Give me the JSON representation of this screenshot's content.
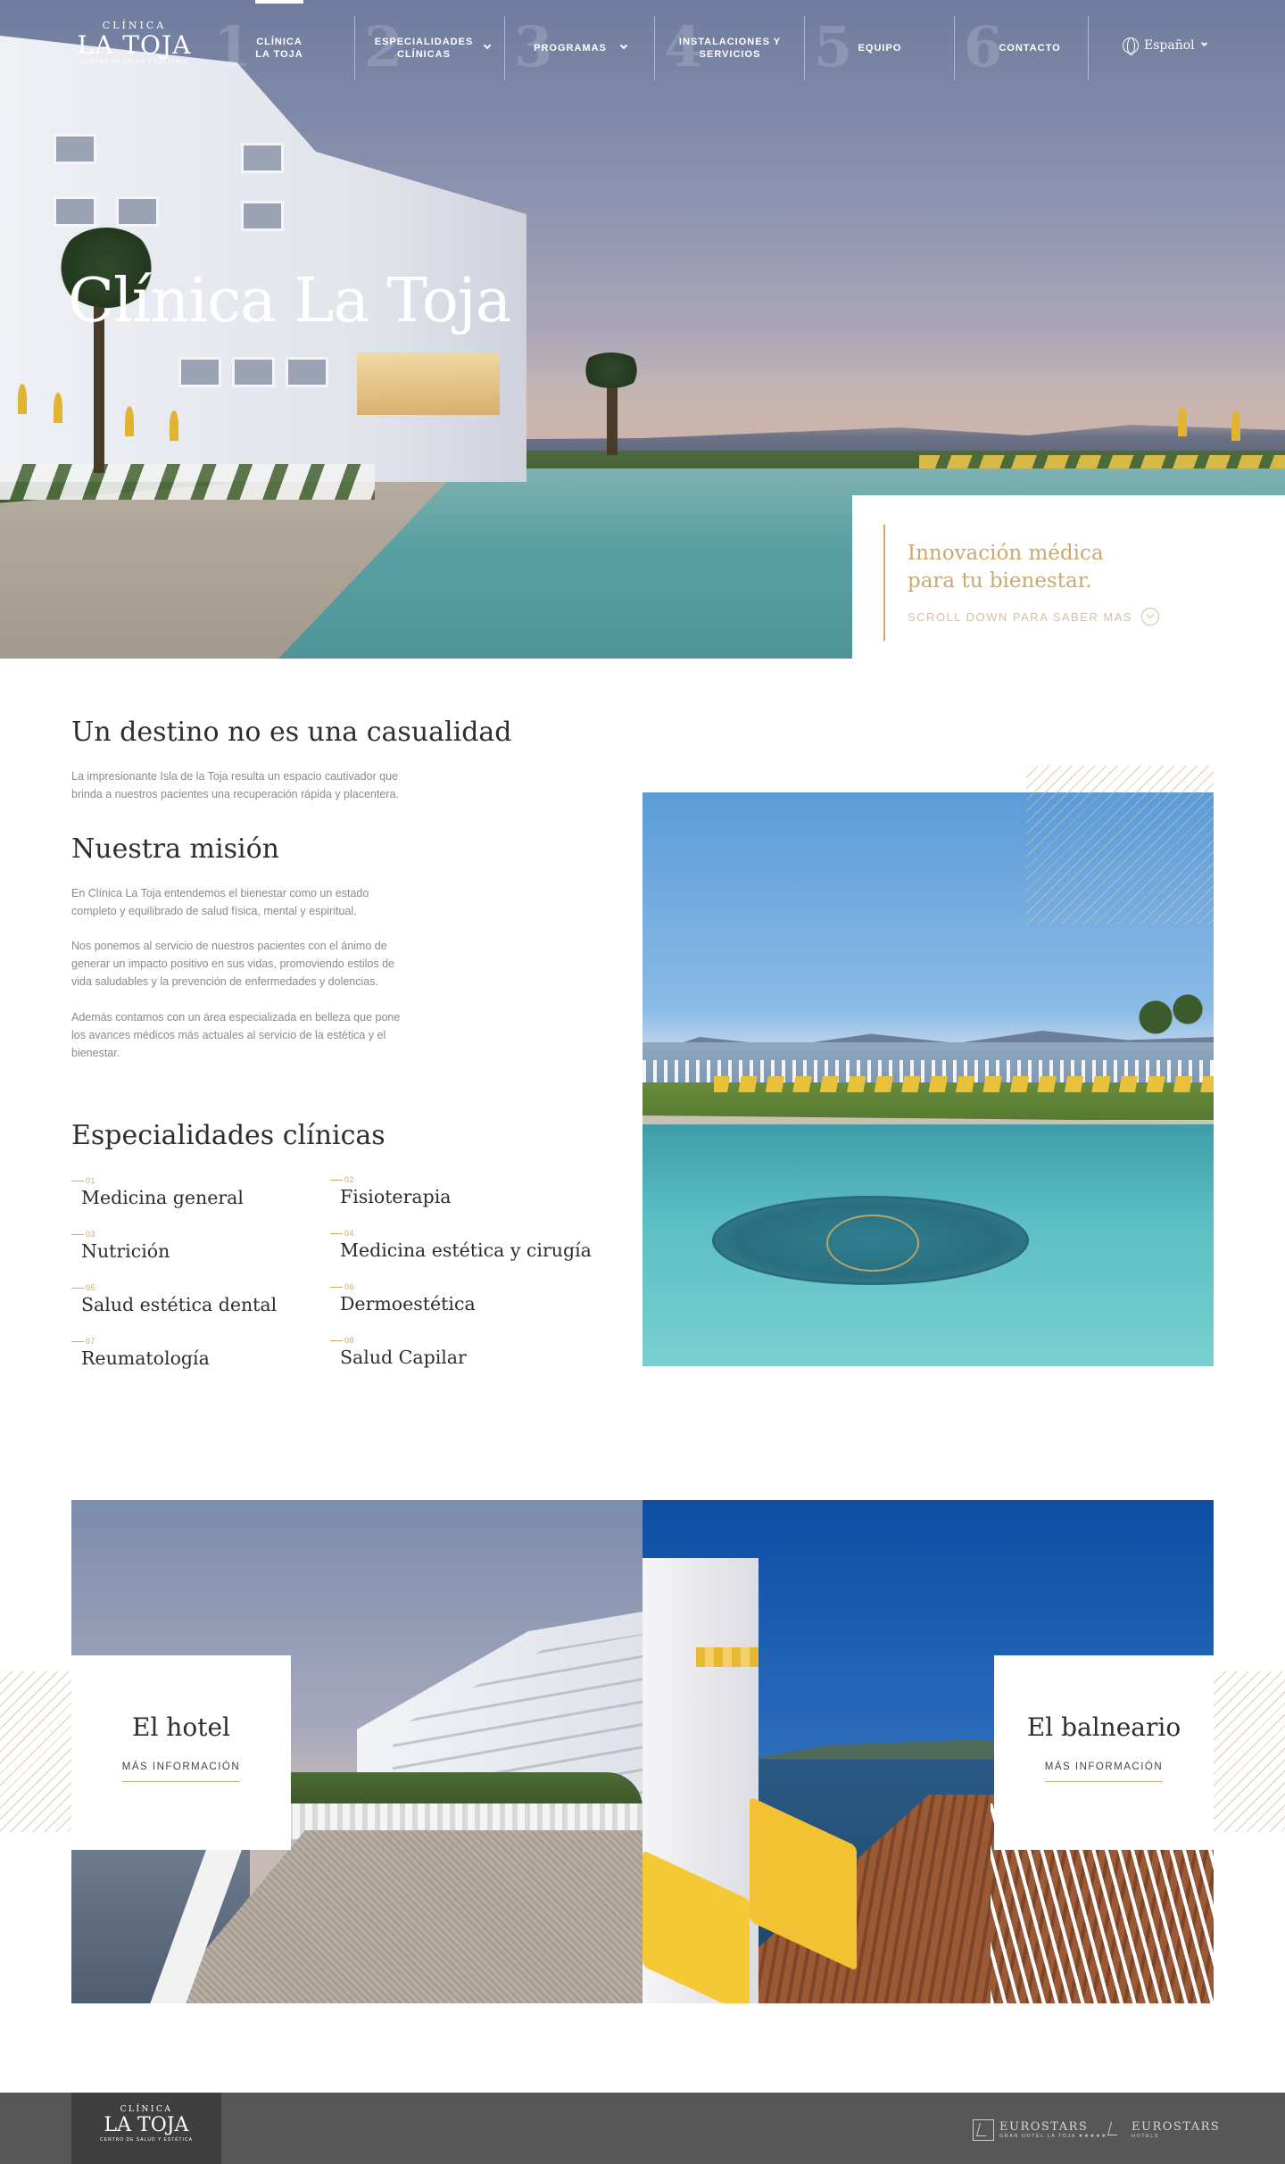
{
  "brand": {
    "line1": "CLÍNICA",
    "line2": "LA TOJA",
    "line3": "CENTRO DE SALUD Y ESTÉTICA"
  },
  "nav": {
    "items": [
      {
        "num": "1",
        "label": "CLÍNICA LA TOJA",
        "dropdown": false,
        "active": true
      },
      {
        "num": "2",
        "label": "ESPECIALIDADES CLÍNICAS",
        "dropdown": true
      },
      {
        "num": "3",
        "label": "PROGRAMAS",
        "dropdown": true
      },
      {
        "num": "4",
        "label": "INSTALACIONES Y SERVICIOS",
        "dropdown": false
      },
      {
        "num": "5",
        "label": "EQUIPO",
        "dropdown": false
      },
      {
        "num": "6",
        "label": "CONTACTO",
        "dropdown": false
      }
    ],
    "language": "Español"
  },
  "hero": {
    "title": "Clínica La Toja",
    "tagline_1": "Innovación médica",
    "tagline_2": "para tu bienestar.",
    "scroll": "SCROLL DOWN PARA SABER MAS"
  },
  "intro": {
    "destino_title": "Un destino no es una casualidad",
    "destino_text_1": "La impresionante Isla de la Toja resulta un espacio cautivador que",
    "destino_text_2": "brinda a nuestros pacientes una recuperación rápida y placentera.",
    "mision_title": "Nuestra misión",
    "mision_p1_1": "En Clínica La Toja entendemos el bienestar como un estado",
    "mision_p1_2": "completo y equilibrado de salud física, mental y espiritual.",
    "mision_p2_1": "Nos ponemos al servicio de nuestros pacientes con el ánimo de",
    "mision_p2_2": "generar un impacto positivo en sus vidas, promoviendo estilos de",
    "mision_p2_3": "vida saludables y la prevención de enfermedades y dolencias.",
    "mision_p3_1": "Además contamos con un área especializada en belleza que pone",
    "mision_p3_2": "los avances médicos más actuales al servicio de la estética y el",
    "mision_p3_3": "bienestar."
  },
  "specialties": {
    "title": "Especialidades clínicas",
    "items": [
      {
        "num": "01",
        "label": "Medicina general"
      },
      {
        "num": "02",
        "label": "Fisioterapia"
      },
      {
        "num": "03",
        "label": "Nutrición"
      },
      {
        "num": "04",
        "label": "Medicina estética y cirugía"
      },
      {
        "num": "05",
        "label": "Salud estética dental"
      },
      {
        "num": "06",
        "label": "Dermoestética"
      },
      {
        "num": "07",
        "label": "Reumatología"
      },
      {
        "num": "08",
        "label": "Salud Capilar"
      }
    ]
  },
  "cards": {
    "hotel_title": "El hotel",
    "hotel_link": "MÁS INFORMACIÓN",
    "spa_title": "El balneario",
    "spa_link": "MÁS INFORMACIÓN"
  },
  "footer": {
    "partner1_a": "EUROSTARS",
    "partner1_b": "GRAN HOTEL LA TOJA ★★★★★",
    "partner2_a": "EUROSTARS",
    "partner2_b": "HOTELS"
  },
  "colors": {
    "accent_gold": "#c9a96e",
    "footer_bg": "#575757",
    "footer_logo_bg": "#3f3f3f"
  }
}
